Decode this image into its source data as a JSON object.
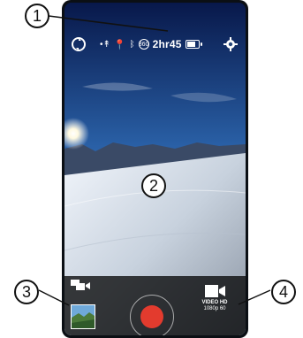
{
  "status_bar": {
    "battery_time": "2hr45",
    "icons": [
      "sync-icon",
      "location-icon",
      "bluetooth-icon",
      "360-icon",
      "battery-icon"
    ]
  },
  "camera": {
    "mode_title": "VIDEO HD",
    "mode_detail": "1080p 60"
  },
  "callouts": [
    "1",
    "2",
    "3",
    "4"
  ],
  "colors": {
    "record": "#e33b2e",
    "sky_top": "#0a1f55",
    "sky_bottom": "#6aa5d8"
  }
}
